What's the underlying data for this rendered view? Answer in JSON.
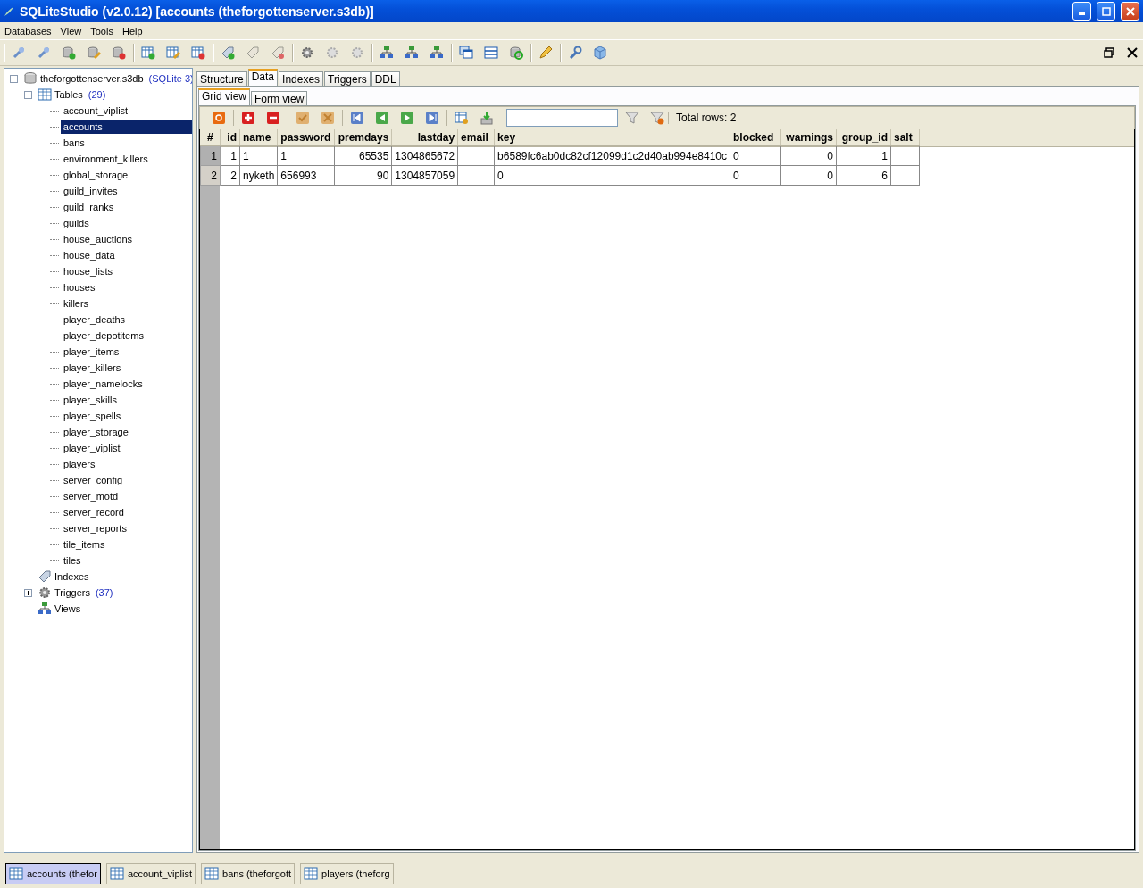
{
  "window": {
    "title": "SQLiteStudio (v2.0.12) [accounts (theforgottenserver.s3db)]"
  },
  "menu": [
    "Databases",
    "View",
    "Tools",
    "Help"
  ],
  "tree": {
    "label": "theforgottenserver.s3db",
    "badge": "(SQLite 3)",
    "expanded": true,
    "children": [
      {
        "label": "Tables",
        "kind": "tables",
        "count": "(29)",
        "expanded": true,
        "children": [
          {
            "label": "account_viplist",
            "selected": false
          },
          {
            "label": "accounts",
            "selected": true
          },
          {
            "label": "bans",
            "selected": false
          },
          {
            "label": "environment_killers",
            "selected": false
          },
          {
            "label": "global_storage",
            "selected": false
          },
          {
            "label": "guild_invites",
            "selected": false
          },
          {
            "label": "guild_ranks",
            "selected": false
          },
          {
            "label": "guilds",
            "selected": false
          },
          {
            "label": "house_auctions",
            "selected": false
          },
          {
            "label": "house_data",
            "selected": false
          },
          {
            "label": "house_lists",
            "selected": false
          },
          {
            "label": "houses",
            "selected": false
          },
          {
            "label": "killers",
            "selected": false
          },
          {
            "label": "player_deaths",
            "selected": false
          },
          {
            "label": "player_depotitems",
            "selected": false
          },
          {
            "label": "player_items",
            "selected": false
          },
          {
            "label": "player_killers",
            "selected": false
          },
          {
            "label": "player_namelocks",
            "selected": false
          },
          {
            "label": "player_skills",
            "selected": false
          },
          {
            "label": "player_spells",
            "selected": false
          },
          {
            "label": "player_storage",
            "selected": false
          },
          {
            "label": "player_viplist",
            "selected": false
          },
          {
            "label": "players",
            "selected": false
          },
          {
            "label": "server_config",
            "selected": false
          },
          {
            "label": "server_motd",
            "selected": false
          },
          {
            "label": "server_record",
            "selected": false
          },
          {
            "label": "server_reports",
            "selected": false
          },
          {
            "label": "tile_items",
            "selected": false
          },
          {
            "label": "tiles",
            "selected": false
          }
        ]
      },
      {
        "label": "Indexes",
        "kind": "indexes"
      },
      {
        "label": "Triggers",
        "kind": "triggers",
        "count": "(37)",
        "expanded": false
      },
      {
        "label": "Views",
        "kind": "views"
      }
    ]
  },
  "tabs": [
    {
      "label": "Structure",
      "selected": false
    },
    {
      "label": "Data",
      "selected": true
    },
    {
      "label": "Indexes",
      "selected": false
    },
    {
      "label": "Triggers",
      "selected": false
    },
    {
      "label": "DDL",
      "selected": false
    }
  ],
  "view_tabs": [
    {
      "label": "Grid view",
      "selected": true
    },
    {
      "label": "Form view",
      "selected": false
    }
  ],
  "total_rows": "Total rows: 2",
  "grid": {
    "columns": [
      {
        "label": "#",
        "kind": "rownum"
      },
      {
        "label": "id",
        "kind": "number"
      },
      {
        "label": "name",
        "kind": "text"
      },
      {
        "label": "password",
        "kind": "text"
      },
      {
        "label": "premdays",
        "kind": "number"
      },
      {
        "label": "lastday",
        "kind": "number"
      },
      {
        "label": "email",
        "kind": "text"
      },
      {
        "label": "key",
        "kind": "text"
      },
      {
        "label": "blocked",
        "kind": "text"
      },
      {
        "label": "warnings",
        "kind": "number"
      },
      {
        "label": "group_id",
        "kind": "number"
      },
      {
        "label": "salt",
        "kind": "text"
      }
    ],
    "rows": [
      {
        "selected": true,
        "cells": [
          "1",
          "1",
          "1",
          "1",
          "65535",
          "1304865672",
          "",
          "b6589fc6ab0dc82cf12099d1c2d40ab994e8410c",
          "0",
          "0",
          "1",
          ""
        ]
      },
      {
        "selected": false,
        "cells": [
          "2",
          "2",
          "nyketh",
          "656993",
          "90",
          "1304857059",
          "",
          "0",
          "0",
          "0",
          "6",
          ""
        ]
      }
    ]
  },
  "taskbar": [
    {
      "label": "accounts (thefor",
      "selected": true
    },
    {
      "label": "account_viplist",
      "selected": false
    },
    {
      "label": "bans (theforgott",
      "selected": false
    },
    {
      "label": "players (theforg",
      "selected": false
    }
  ]
}
